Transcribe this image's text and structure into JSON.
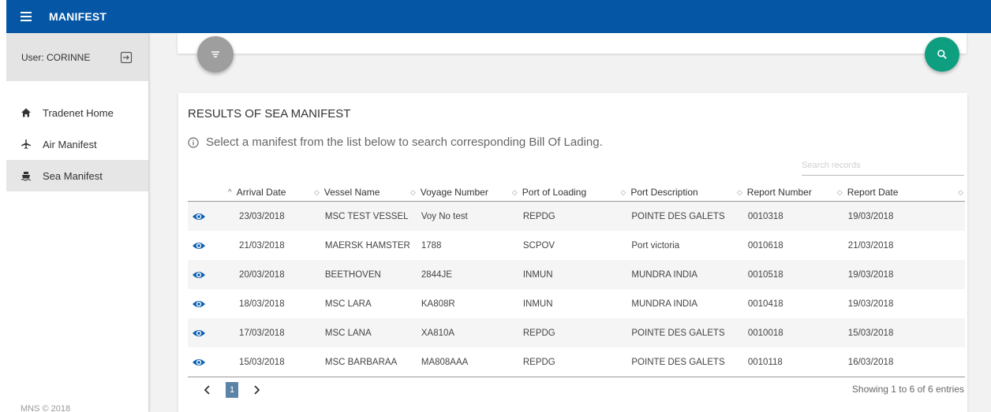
{
  "app": {
    "title": "MANIFEST"
  },
  "sidebar": {
    "user_label": "User: CORINNE",
    "items": [
      {
        "label": "Tradenet Home",
        "icon": "home-icon"
      },
      {
        "label": "Air Manifest",
        "icon": "airplane-icon"
      },
      {
        "label": "Sea Manifest",
        "icon": "ship-icon",
        "active": true
      }
    ],
    "footer": "MNS © 2018"
  },
  "results": {
    "title": "RESULTS OF SEA MANIFEST",
    "info": "Select a manifest from the list below to search corresponding Bill Of Lading.",
    "search_placeholder": "Search records",
    "columns": [
      "Arrival Date",
      "Vessel Name",
      "Voyage Number",
      "Port of Loading",
      "Port Description",
      "Report Number",
      "Report Date"
    ],
    "rows": [
      [
        "23/03/2018",
        "MSC TEST VESSEL",
        "Voy No test",
        "REPDG",
        "POINTE DES GALETS",
        "0010318",
        "19/03/2018"
      ],
      [
        "21/03/2018",
        "MAERSK HAMSTER",
        "1788",
        "SCPOV",
        "Port victoria",
        "0010618",
        "21/03/2018"
      ],
      [
        "20/03/2018",
        "BEETHOVEN",
        "2844JE",
        "INMUN",
        "MUNDRA INDIA",
        "0010518",
        "19/03/2018"
      ],
      [
        "18/03/2018",
        "MSC LARA",
        "KA808R",
        "INMUN",
        "MUNDRA INDIA",
        "0010418",
        "19/03/2018"
      ],
      [
        "17/03/2018",
        "MSC LANA",
        "XA810A",
        "REPDG",
        "POINTE DES GALETS",
        "0010018",
        "15/03/2018"
      ],
      [
        "15/03/2018",
        "MSC BARBARAA",
        "MA808AAA",
        "REPDG",
        "POINTE DES GALETS",
        "0010118",
        "16/03/2018"
      ]
    ],
    "pagination": {
      "current_page": "1",
      "showing": "Showing 1 to 6 of 6 entries"
    }
  },
  "colors": {
    "topbar": "#0557a5",
    "search_fab": "#0e9e80",
    "menu_fab": "#9e9e9e",
    "eye_icon": "#0b5fb0",
    "page_active": "#5b83a6"
  }
}
